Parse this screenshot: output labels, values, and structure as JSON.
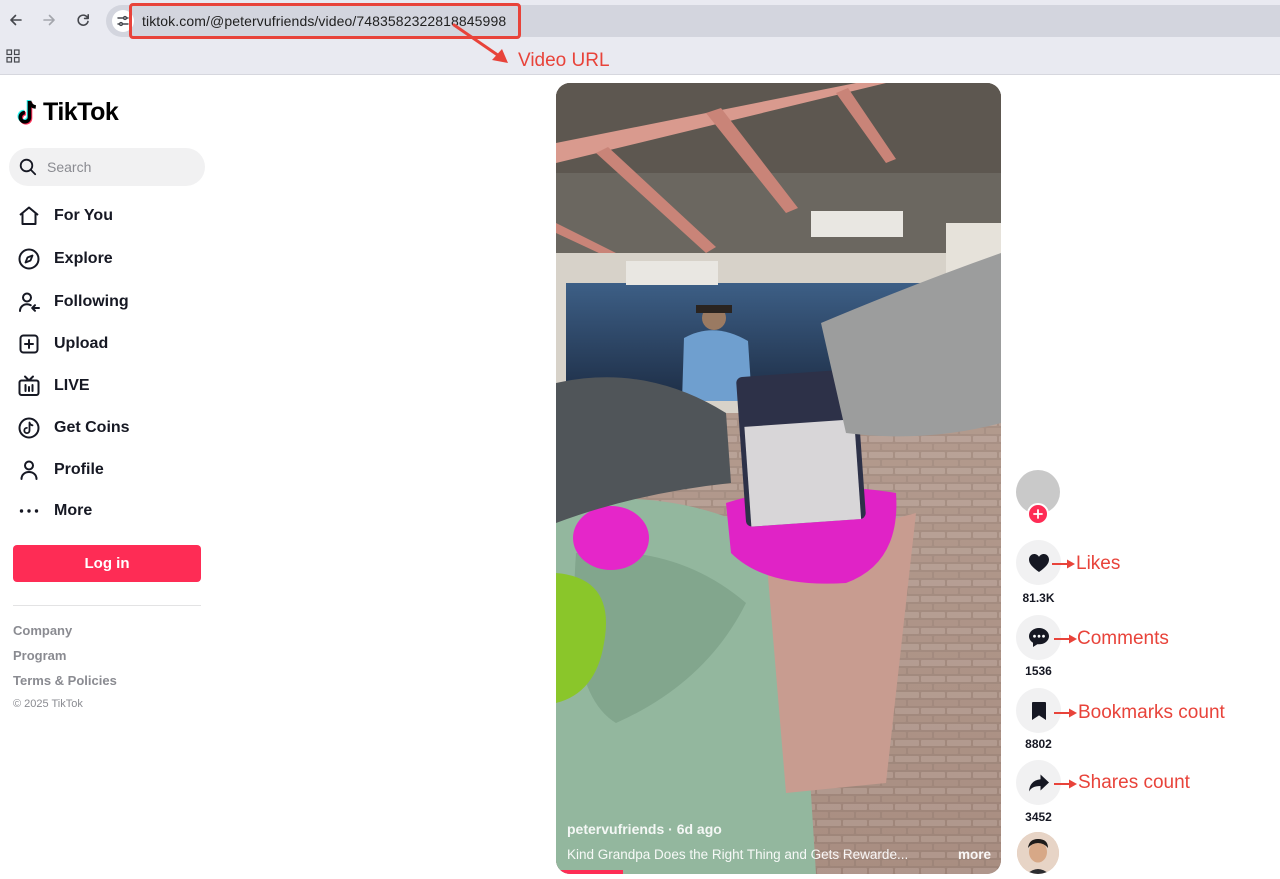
{
  "browser": {
    "url": "tiktok.com/@petervufriends/video/7483582322818845998"
  },
  "annotations": {
    "video_url": "Video URL",
    "likes": "Likes",
    "comments": "Comments",
    "bookmarks": "Bookmarks count",
    "shares": "Shares count",
    "color": "#e8433a"
  },
  "sidebar": {
    "logo_text": "TikTok",
    "search_placeholder": "Search",
    "menu": [
      {
        "label": "For You",
        "icon": "home-icon"
      },
      {
        "label": "Explore",
        "icon": "compass-icon"
      },
      {
        "label": "Following",
        "icon": "following-icon"
      },
      {
        "label": "Upload",
        "icon": "upload-icon"
      },
      {
        "label": "LIVE",
        "icon": "live-tv-icon"
      },
      {
        "label": "Get Coins",
        "icon": "coin-icon"
      },
      {
        "label": "Profile",
        "icon": "profile-icon"
      },
      {
        "label": "More",
        "icon": "more-dots-icon"
      }
    ],
    "login_label": "Log in",
    "footer": {
      "links": [
        "Company",
        "Program",
        "Terms & Policies"
      ],
      "copyright": "© 2025 TikTok"
    }
  },
  "video": {
    "author": "petervufriends",
    "age": "6d ago",
    "author_line": "petervufriends · 6d ago",
    "description": "Kind Grandpa Does the Right Thing and Gets Rewarde...",
    "more_label": "more",
    "progress_fraction": 0.15
  },
  "actions": {
    "likes": "81.3K",
    "comments": "1536",
    "bookmarks": "8802",
    "shares": "3452"
  },
  "colors": {
    "brand": "#fe2c55",
    "text": "#161823",
    "muted": "#8a8b91"
  }
}
